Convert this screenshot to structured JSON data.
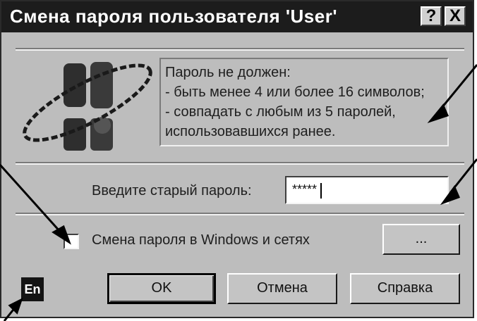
{
  "window": {
    "title": "Смена пароля пользователя 'User'",
    "help_button": "?",
    "close_button": "X"
  },
  "info": {
    "line1": "Пароль не должен:",
    "line2": "- быть менее 4 или более 16 символов;",
    "line3": "- совпадать с любым из 5 паролей,",
    "line4": "использовавшихся ранее."
  },
  "form": {
    "old_password_label": "Введите старый пароль:",
    "old_password_value": "*****",
    "network_checkbox_label": "Смена пароля в Windows и сетях",
    "network_checkbox_checked": false,
    "browse_button": "..."
  },
  "buttons": {
    "ok": "OK",
    "cancel": "Отмена",
    "help": "Справка"
  },
  "status": {
    "language_indicator": "En"
  },
  "icons": {
    "warning": "exclamation-orbit-icon"
  }
}
